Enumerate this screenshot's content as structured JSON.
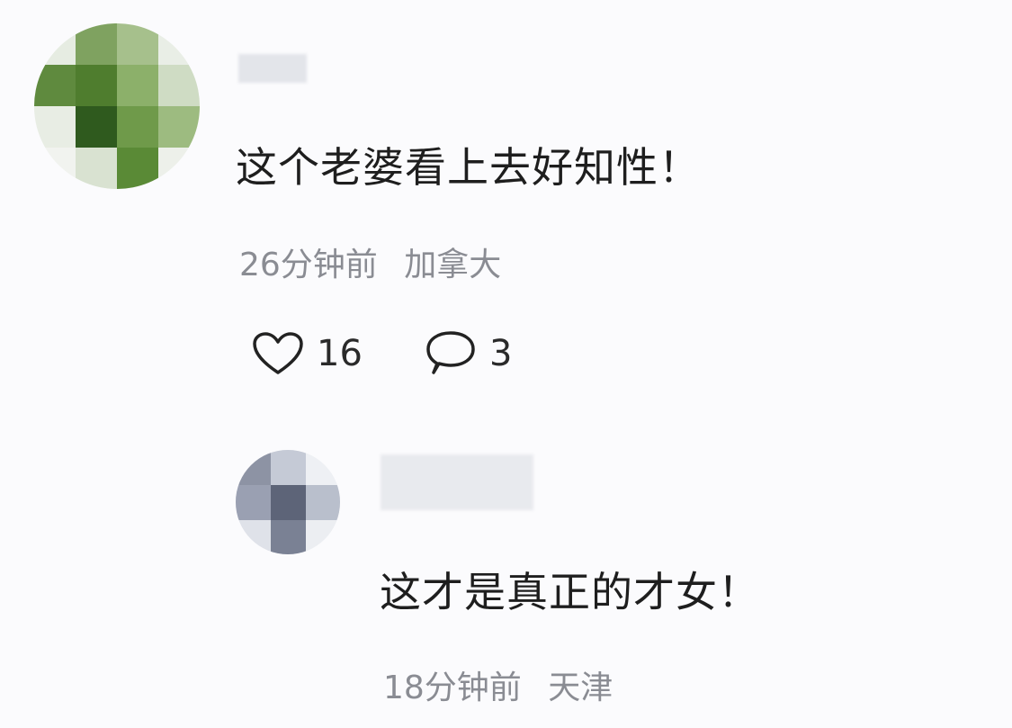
{
  "comments": [
    {
      "text": "这个老婆看上去好知性！",
      "time": "26分钟前",
      "location": "加拿大",
      "likes": "16",
      "replies": "3",
      "icons": {
        "like": "heart-icon",
        "reply": "speech-bubble-icon"
      }
    },
    {
      "text": "这才是真正的才女！",
      "time": "18分钟前",
      "location": "天津"
    }
  ]
}
